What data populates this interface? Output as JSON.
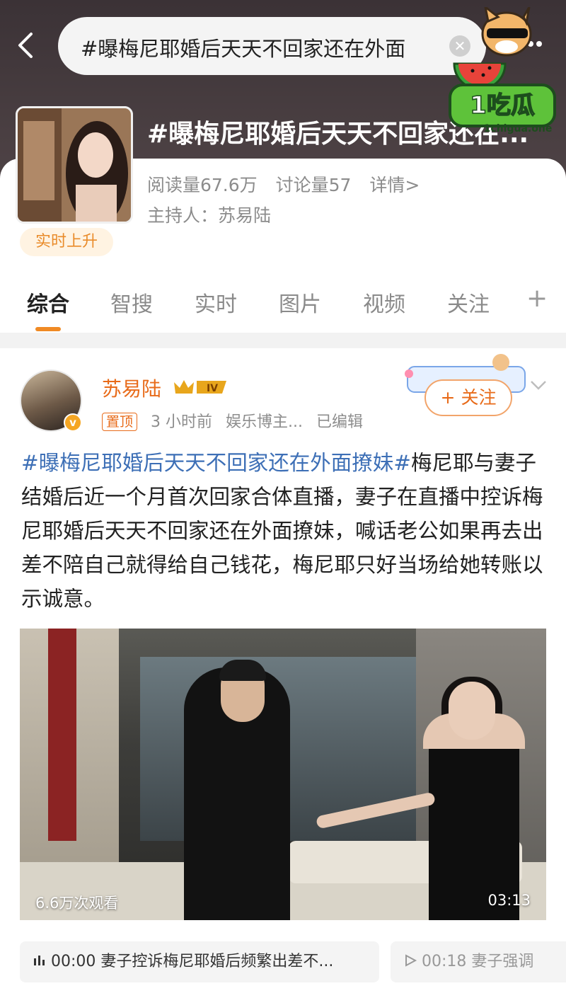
{
  "header": {
    "search_text": "#曝梅尼耶婚后天天不回家还在外面",
    "topic_title": "#曝梅尼耶婚后天天不回家还在...",
    "stats": {
      "reads": "阅读量67.6万",
      "discussions": "讨论量57",
      "details": "详情>"
    },
    "host": "主持人：苏易陆",
    "rising_badge": "实时上升"
  },
  "tabs": [
    {
      "label": "综合",
      "active": true
    },
    {
      "label": "智搜"
    },
    {
      "label": "实时"
    },
    {
      "label": "图片"
    },
    {
      "label": "视频"
    },
    {
      "label": "关注"
    }
  ],
  "plus_tab": "+",
  "logo": {
    "text": "1吃瓜",
    "url_text": "1chigua.one"
  },
  "post": {
    "author": "苏易陆",
    "level_badge": "IV",
    "pinned": "置顶",
    "time": "3 小时前",
    "source": "娱乐博主...",
    "edited": "已编辑",
    "follow_label": "+ 关注",
    "hashtag": "#曝梅尼耶婚后天天不回家还在外面撩妹#",
    "body": "梅尼耶与妻子结婚后近一个月首次回家合体直播，妻子在直播中控诉梅尼耶婚后天天不回家还在外面撩妹，喊话老公如果再去出差不陪自己就得给自己钱花，梅尼耶只好当场给她转账以示诚意。",
    "video": {
      "views": "6.6万次观看",
      "duration": "03:13"
    },
    "chapters": [
      {
        "time": "00:00",
        "title": "妻子控诉梅尼耶婚后频繁出差不..."
      },
      {
        "time": "00:18",
        "title": "妻子强调"
      }
    ]
  },
  "colors": {
    "accent_orange": "#e86b1a",
    "hashtag_blue": "#3d6fb6",
    "tab_underline": "#f08a24"
  }
}
